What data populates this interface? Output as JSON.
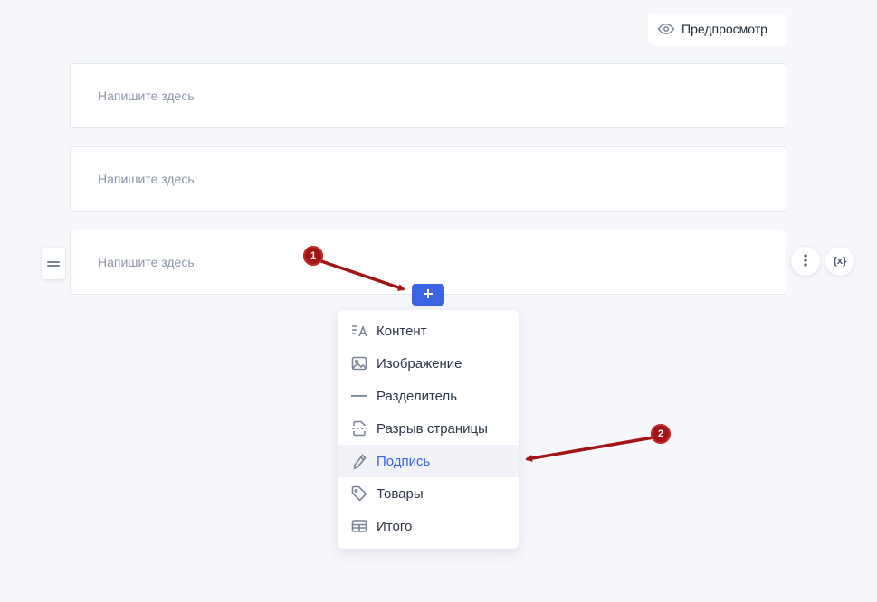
{
  "header": {
    "preview_label": "Предпросмотр",
    "preview_icon": "eye-icon"
  },
  "blocks": [
    {
      "placeholder": "Напишите здесь"
    },
    {
      "placeholder": "Напишите здесь"
    },
    {
      "placeholder": "Напишите здесь"
    }
  ],
  "block_actions": {
    "variables_label": "{x}",
    "more_icon": "more-vertical-icon",
    "drag_icon": "drag-handle-icon"
  },
  "add_button": {
    "label": "+"
  },
  "insert_menu": {
    "items": [
      {
        "label": "Контент",
        "icon": "text-content-icon"
      },
      {
        "label": "Изображение",
        "icon": "image-icon"
      },
      {
        "label": "Разделитель",
        "icon": "divider-icon"
      },
      {
        "label": "Разрыв страницы",
        "icon": "page-break-icon"
      },
      {
        "label": "Подпись",
        "icon": "pen-icon",
        "active": true
      },
      {
        "label": "Товары",
        "icon": "tag-icon"
      },
      {
        "label": "Итого",
        "icon": "total-table-icon"
      }
    ]
  },
  "annotations": {
    "marker_1": "1",
    "marker_2": "2"
  },
  "colors": {
    "accent": "#3b63e3",
    "annotation": "#a31515",
    "background": "#f7f8fc"
  }
}
